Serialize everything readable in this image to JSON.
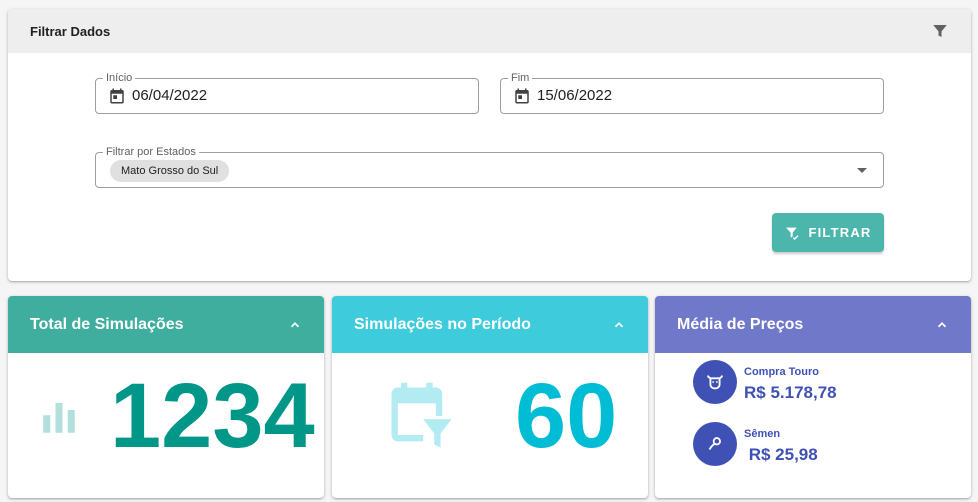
{
  "filter": {
    "title": "Filtrar Dados",
    "start": {
      "label": "Início",
      "value": "06/04/2022"
    },
    "end": {
      "label": "Fim",
      "value": "15/06/2022"
    },
    "states": {
      "label": "Filtrar por Estados",
      "selected": "Mato Grosso do Sul"
    },
    "button_label": "FILTRAR"
  },
  "cards": {
    "total": {
      "title": "Total de Simulações",
      "value": "1234",
      "color": "#3fae9f"
    },
    "period": {
      "title": "Simulações no Período",
      "value": "60",
      "color": "#3ecbdc"
    },
    "prices": {
      "title": "Média de Preços",
      "color": "#7078c9",
      "items": [
        {
          "label": "Compra Touro",
          "value": "R$ 5.178,78",
          "icon": "bull-icon"
        },
        {
          "label": "Sêmen",
          "value": " R$ 25,98",
          "icon": "semen-icon"
        }
      ]
    }
  },
  "colors": {
    "accent_teal": "#4db6ac",
    "number_teal": "#009688",
    "number_cyan": "#00bcd4",
    "indigo": "#3f51b5"
  }
}
